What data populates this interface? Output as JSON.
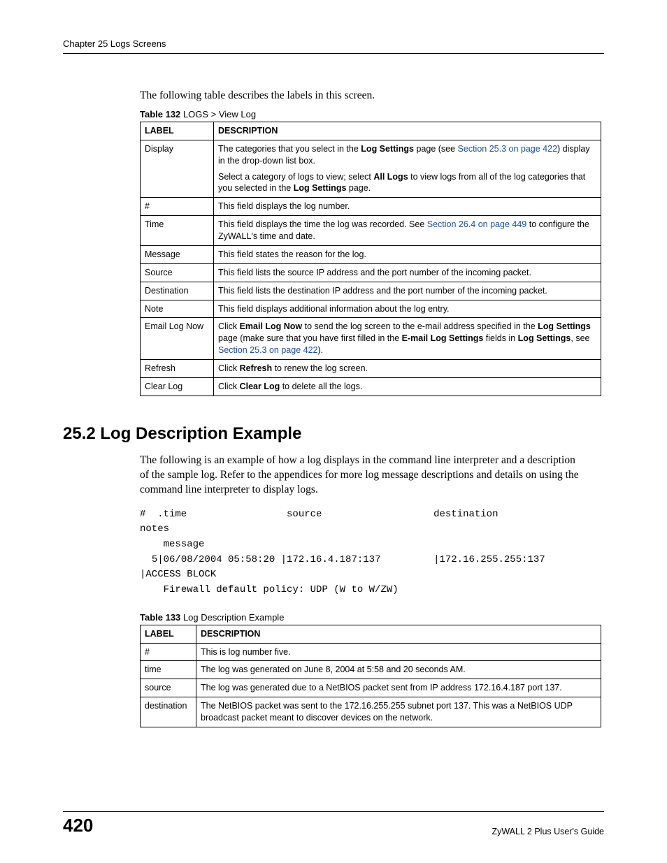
{
  "header": {
    "chapter": "Chapter 25 Logs Screens"
  },
  "intro": "The following table describes the labels in this screen.",
  "table132": {
    "caption_bold": "Table 132",
    "caption_rest": "   LOGS > View Log",
    "head_label": "LABEL",
    "head_desc": "DESCRIPTION",
    "rows": [
      {
        "label": "Display",
        "parts": [
          {
            "t": "plain",
            "v": "The categories that you select in the "
          },
          {
            "t": "bold",
            "v": "Log Settings"
          },
          {
            "t": "plain",
            "v": " page (see "
          },
          {
            "t": "link",
            "v": "Section 25.3 on page 422"
          },
          {
            "t": "plain",
            "v": ") display in the drop-down list box."
          }
        ],
        "parts2": [
          {
            "t": "plain",
            "v": "Select a category of logs to view; select "
          },
          {
            "t": "bold",
            "v": "All Logs"
          },
          {
            "t": "plain",
            "v": " to view logs from all of the log categories that you selected in the "
          },
          {
            "t": "bold",
            "v": "Log Settings"
          },
          {
            "t": "plain",
            "v": " page."
          }
        ]
      },
      {
        "label": "#",
        "parts": [
          {
            "t": "plain",
            "v": "This field displays the log number."
          }
        ]
      },
      {
        "label": "Time",
        "parts": [
          {
            "t": "plain",
            "v": "This field displays the time the log was recorded. See "
          },
          {
            "t": "link",
            "v": "Section 26.4 on page 449"
          },
          {
            "t": "plain",
            "v": " to configure the ZyWALL's time and date."
          }
        ]
      },
      {
        "label": "Message",
        "parts": [
          {
            "t": "plain",
            "v": "This field states the reason for the log."
          }
        ]
      },
      {
        "label": "Source",
        "parts": [
          {
            "t": "plain",
            "v": "This field lists the source IP address and the port number of the incoming packet."
          }
        ]
      },
      {
        "label": "Destination",
        "parts": [
          {
            "t": "plain",
            "v": "This field lists the destination IP address and the port number of the incoming packet."
          }
        ]
      },
      {
        "label": "Note",
        "parts": [
          {
            "t": "plain",
            "v": "This field displays additional information about the log entry."
          }
        ]
      },
      {
        "label": "Email Log Now",
        "parts": [
          {
            "t": "plain",
            "v": "Click "
          },
          {
            "t": "bold",
            "v": "Email Log Now"
          },
          {
            "t": "plain",
            "v": " to send the log screen to the e-mail address specified in the "
          },
          {
            "t": "bold",
            "v": "Log Settings"
          },
          {
            "t": "plain",
            "v": " page (make sure that you have first filled in the "
          },
          {
            "t": "bold",
            "v": "E-mail Log Settings"
          },
          {
            "t": "plain",
            "v": " fields in "
          },
          {
            "t": "bold",
            "v": "Log Settings"
          },
          {
            "t": "plain",
            "v": ", see "
          },
          {
            "t": "link",
            "v": "Section 25.3 on page 422"
          },
          {
            "t": "plain",
            "v": ")."
          }
        ]
      },
      {
        "label": "Refresh",
        "parts": [
          {
            "t": "plain",
            "v": "Click "
          },
          {
            "t": "bold",
            "v": "Refresh"
          },
          {
            "t": "plain",
            "v": " to renew the log screen."
          }
        ]
      },
      {
        "label": "Clear Log",
        "parts": [
          {
            "t": "plain",
            "v": "Click "
          },
          {
            "t": "bold",
            "v": "Clear Log"
          },
          {
            "t": "plain",
            "v": " to delete all the logs."
          }
        ]
      }
    ]
  },
  "section": {
    "title": "25.2  Log Description Example"
  },
  "section_body": "The following is an example of how a log displays in the command line interpreter and a description of the sample log. Refer to the appendices for more log message descriptions and details on using the command line interpreter to display logs.",
  "code": "#  .time                 source                   destination                         notes\n    message\n  5|06/08/2004 05:58:20 |172.16.4.187:137         |172.16.255.255:137       |ACCESS BLOCK\n    Firewall default policy: UDP (W to W/ZW)",
  "table133": {
    "caption_bold": "Table 133",
    "caption_rest": "   Log Description Example",
    "head_label": "LABEL",
    "head_desc": "DESCRIPTION",
    "rows": [
      {
        "label": "#",
        "parts": [
          {
            "t": "plain",
            "v": "This is log number five."
          }
        ]
      },
      {
        "label": "time",
        "parts": [
          {
            "t": "plain",
            "v": "The log was generated on June 8, 2004 at 5:58 and 20 seconds AM."
          }
        ]
      },
      {
        "label": "source",
        "parts": [
          {
            "t": "plain",
            "v": "The log was generated due to a NetBIOS packet sent from IP address 172.16.4.187 port 137."
          }
        ]
      },
      {
        "label": "destination",
        "parts": [
          {
            "t": "plain",
            "v": "The NetBIOS packet was sent to the 172.16.255.255 subnet port 137. This was a NetBIOS UDP broadcast packet meant to discover devices on the network."
          }
        ]
      }
    ]
  },
  "footer": {
    "page": "420",
    "guide": "ZyWALL 2 Plus User's Guide"
  }
}
